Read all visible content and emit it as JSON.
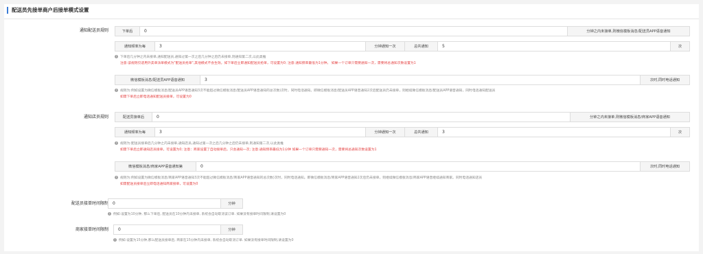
{
  "title": "配送员先接单商户后接单模式设置",
  "rider_notify": {
    "label": "通知配送员规则",
    "after_prefix": "下单后",
    "after_value": "0",
    "after_suffix": "分钟之内未接单,则微信模板消息/配送员APP语音通知",
    "freq_prefix": "通知频率为每",
    "freq_value": "3",
    "freq_mid": "分钟通知一次",
    "total_prefix": "总共通知",
    "total_value": "5",
    "total_suffix": "次",
    "note1": "下单后几分钟之内未接单,通知配送员,通知过第一次之后几分钟之后仍未接单,则通知第二次,以此类推",
    "note2": "注意:该规则仅适用外卖单派单模式为\"配送员抢单\",其他模式不会生效。如下单后立即通知配送员抢单，可设置为0; 注意:通知频率最低为1分钟。 如果一个订单只需要通知一次，需要将总通知次数设置为1",
    "phone_prefix": "微信模板消息/配送员APP语音通知",
    "phone_value": "3",
    "phone_suffix": "次时,同时电话通知",
    "note3": "规则为:例如设置为微信模板消息/配送员APP语音通知3次不能超过微信模板消息/配送员APP语音通知的总次数)次时，同时电话通知。即微信模板消息/配送员APP语音通知2次后配送员仍未接单，则继续微信模板消息/配送员APP语音通知，同时电话通知配送员",
    "note4": "如需下单后立即电话通知配送员接单，可设置为0"
  },
  "store_notify": {
    "label": "通知店员规则",
    "after_prefix": "配送员接单后",
    "after_value": "0",
    "after_suffix": "分钟之内未接单,则微信模板消息/商家APP语音通知",
    "freq_prefix": "通知频率为每",
    "freq_value": "3",
    "freq_mid": "分钟通知一次",
    "total_prefix": "总共通知",
    "total_value": "3",
    "total_suffix": "次",
    "note1": "规则为:配送员接单后几分钟之内未接单,通知店员,通知过第一次之后几分钟之后仍未接单,则通知第二次,以此类推",
    "note2": "如需下单后立即通知店员接单，可设置为0; 注意：商家设置了自动接单后，只会通知一次; 注意:通知频率最低为1分钟 如果一个订单只需要通知一次，需要将总通知次数设置为1",
    "phone_prefix": "微信模板消息/商家APP语音通知第",
    "phone_value": "0",
    "phone_suffix": "次时,同时电话通知",
    "note3": "规则为:例如设置为微信模板消息/商家APP语音通知3次不能超过微信模板消息/商家APP语音通知的总次数)次时，同时电话通知。即微信模板消息/商家APP语音通知2次后仍未接单，则继续微信模板消息/商家APP语音继续通知商家。同时电话通知店员",
    "note4": "如需配送员接单后立即电话通知商家接单，可设置为0"
  },
  "rider_limit": {
    "label": "配送员接单时间限制",
    "value": "0",
    "suffix": "分钟",
    "note": "例如:设置为10分钟, 那么下单后, 配送员在10分钟内未接单, 系统会自动取消该订单. 如果没有接单时间限制,请设置为0"
  },
  "store_limit": {
    "label": "商家接单时间限制",
    "value": "0",
    "suffix": "分钟",
    "note": "例如:设置为15分钟,那么配送员接单后, 商家在15分钟内未接单, 系统会自动取消订单. 如果没有接单时间限制,请设置为0"
  },
  "colors": {
    "accent": "#3a7bd5",
    "warning": "#e54545"
  },
  "icons": {
    "info": "info-circle-icon"
  }
}
